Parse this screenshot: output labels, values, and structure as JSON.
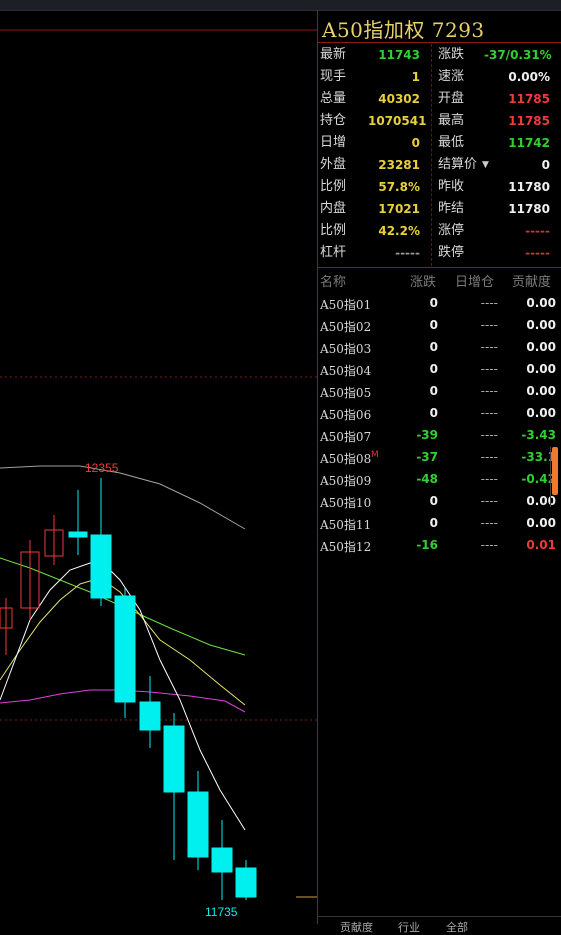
{
  "title": "A50指加权  7293",
  "quote": {
    "rows": [
      {
        "l_label": "最新",
        "l_value": "11743",
        "l_color": "green",
        "r_label": "涨跌",
        "r_value": "-37/0.31%",
        "r_color": "green"
      },
      {
        "l_label": "现手",
        "l_value": "1",
        "l_color": "yellow",
        "r_label": "速涨",
        "r_value": "0.00%",
        "r_color": "white"
      },
      {
        "l_label": "总量",
        "l_value": "40302",
        "l_color": "yellow",
        "r_label": "开盘",
        "r_value": "11785",
        "r_color": "red"
      },
      {
        "l_label": "持仓",
        "l_value": "1070541",
        "l_color": "yellow",
        "r_label": "最高",
        "r_value": "11785",
        "r_color": "red"
      },
      {
        "l_label": "日增",
        "l_value": "0",
        "l_color": "yellow",
        "r_label": "最低",
        "r_value": "11742",
        "r_color": "green"
      },
      {
        "l_label": "外盘",
        "l_value": "23281",
        "l_color": "yellow",
        "r_label": "结算价",
        "r_value": "0",
        "r_color": "white"
      },
      {
        "l_label": "比例",
        "l_value": "57.8%",
        "l_color": "yellow",
        "r_label": "昨收",
        "r_value": "11780",
        "r_color": "white"
      },
      {
        "l_label": "内盘",
        "l_value": "17021",
        "l_color": "yellow",
        "r_label": "昨结",
        "r_value": "11780",
        "r_color": "white"
      },
      {
        "l_label": "比例",
        "l_value": "42.2%",
        "l_color": "yellow",
        "r_label": "涨停",
        "r_value": "-----",
        "r_color": "dashes"
      },
      {
        "l_label": "杠杆",
        "l_value": "-----",
        "l_color": "gray",
        "r_label": "跌停",
        "r_value": "-----",
        "r_color": "dashes"
      }
    ]
  },
  "table": {
    "headers": [
      "名称",
      "涨跌",
      "日增仓",
      "贡献度"
    ],
    "rows": [
      {
        "name": "A50指01",
        "chg": "0",
        "chg_color": "white",
        "pos": "----",
        "con": "0.00",
        "con_color": "white",
        "mark": ""
      },
      {
        "name": "A50指02",
        "chg": "0",
        "chg_color": "white",
        "pos": "----",
        "con": "0.00",
        "con_color": "white",
        "mark": ""
      },
      {
        "name": "A50指03",
        "chg": "0",
        "chg_color": "white",
        "pos": "----",
        "con": "0.00",
        "con_color": "white",
        "mark": ""
      },
      {
        "name": "A50指04",
        "chg": "0",
        "chg_color": "white",
        "pos": "----",
        "con": "0.00",
        "con_color": "white",
        "mark": ""
      },
      {
        "name": "A50指05",
        "chg": "0",
        "chg_color": "white",
        "pos": "----",
        "con": "0.00",
        "con_color": "white",
        "mark": ""
      },
      {
        "name": "A50指06",
        "chg": "0",
        "chg_color": "white",
        "pos": "----",
        "con": "0.00",
        "con_color": "white",
        "mark": ""
      },
      {
        "name": "A50指07",
        "chg": "-39",
        "chg_color": "green",
        "pos": "----",
        "con": "-3.43",
        "con_color": "green",
        "mark": ""
      },
      {
        "name": "A50指08",
        "chg": "-37",
        "chg_color": "green",
        "pos": "----",
        "con": "-33.1",
        "con_color": "green",
        "mark": "M"
      },
      {
        "name": "A50指09",
        "chg": "-48",
        "chg_color": "green",
        "pos": "----",
        "con": "-0.42",
        "con_color": "green",
        "mark": ""
      },
      {
        "name": "A50指10",
        "chg": "0",
        "chg_color": "white",
        "pos": "----",
        "con": "0.00",
        "con_color": "white",
        "mark": ""
      },
      {
        "name": "A50指11",
        "chg": "0",
        "chg_color": "white",
        "pos": "----",
        "con": "0.00",
        "con_color": "white",
        "mark": ""
      },
      {
        "name": "A50指12",
        "chg": "-16",
        "chg_color": "green",
        "pos": "----",
        "con": "0.01",
        "con_color": "red",
        "mark": ""
      }
    ]
  },
  "tabs": [
    "贡献度",
    "行业",
    "全部"
  ],
  "kchart": {
    "high_label": "12355",
    "low_label": "11735"
  },
  "colors": {
    "up": "#f03a3a",
    "down": "#00f0f0",
    "border": "#8b1a1a",
    "ma1": "#ffffff",
    "ma2": "#e8e070",
    "ma3": "#70e040",
    "ma4": "#e040e0",
    "ma5": "#a0a0a0"
  }
}
